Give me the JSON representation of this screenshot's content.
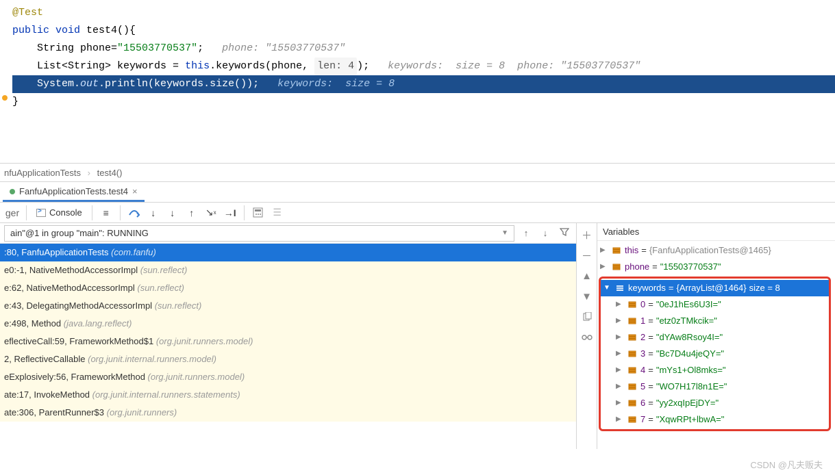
{
  "editor": {
    "l1_ann": "@Test",
    "l2_a": "public ",
    "l2_b": "void ",
    "l2_c": "test4(){",
    "l3_a": "String phone=",
    "l3_b": "\"15503770537\"",
    "l3_c": ";",
    "l3_hint": "phone: \"15503770537\"",
    "l4_a": "List<String> keywords = ",
    "l4_b": "this",
    "l4_c": ".keywords(phone, ",
    "l4_len": "len: 4",
    "l4_d": ");",
    "l4_hint": "keywords:  size = 8  phone: \"15503770537\"",
    "l5_a": "System.",
    "l5_b": "out",
    "l5_c": ".println(keywords.size());",
    "l5_hint": "keywords:  size = 8",
    "l6": "}"
  },
  "breadcrumb": {
    "a": "nfuApplicationTests",
    "b": "test4()"
  },
  "tab": {
    "label": "FanfuApplicationTests.test4",
    "close": "×"
  },
  "toolbar": {
    "ger": "ger",
    "console": "Console"
  },
  "thread": {
    "text": "ain\"@1 in group \"main\": RUNNING",
    "filter_arrow": "↑",
    "filter_down": "↓"
  },
  "stack_sel": {
    "a": ":80, FanfuApplicationTests ",
    "b": "(com.fanfu)"
  },
  "stack": [
    {
      "a": "e0:-1, NativeMethodAccessorImpl ",
      "b": "(sun.reflect)"
    },
    {
      "a": "e:62, NativeMethodAccessorImpl ",
      "b": "(sun.reflect)"
    },
    {
      "a": "e:43, DelegatingMethodAccessorImpl ",
      "b": "(sun.reflect)"
    },
    {
      "a": "e:498, Method ",
      "b": "(java.lang.reflect)"
    },
    {
      "a": "eflectiveCall:59, FrameworkMethod$1 ",
      "b": "(org.junit.runners.model)"
    },
    {
      "a": "2, ReflectiveCallable ",
      "b": "(org.junit.internal.runners.model)"
    },
    {
      "a": "eExplosively:56, FrameworkMethod ",
      "b": "(org.junit.runners.model)"
    },
    {
      "a": "ate:17, InvokeMethod ",
      "b": "(org.junit.internal.runners.statements)"
    },
    {
      "a": "ate:306, ParentRunner$3 ",
      "b": "(org.junit.runners)"
    }
  ],
  "vars": {
    "header": "Variables",
    "this": {
      "name": "this",
      "eq": " = ",
      "val": "{FanfuApplicationTests@1465}"
    },
    "phone": {
      "name": "phone",
      "eq": " = ",
      "val": "\"15503770537\""
    },
    "keywords": {
      "name": "keywords",
      "eq": " = ",
      "obj": "{ArrayList@1464}",
      "size": "  size = 8"
    },
    "items": [
      {
        "idx": "0",
        "eq": " = ",
        "val": "\"0eJ1hEs6U3I=\""
      },
      {
        "idx": "1",
        "eq": " = ",
        "val": "\"etz0zTMkcik=\""
      },
      {
        "idx": "2",
        "eq": " = ",
        "val": "\"dYAw8Rsoy4I=\""
      },
      {
        "idx": "3",
        "eq": " = ",
        "val": "\"Bc7D4u4jeQY=\""
      },
      {
        "idx": "4",
        "eq": " = ",
        "val": "\"mYs1+Ol8mks=\""
      },
      {
        "idx": "5",
        "eq": " = ",
        "val": "\"WO7H17l8n1E=\""
      },
      {
        "idx": "6",
        "eq": " = ",
        "val": "\"yy2xqIpEjDY=\""
      },
      {
        "idx": "7",
        "eq": " = ",
        "val": "\"XqwRPt+lbwA=\""
      }
    ]
  },
  "watermark": "CSDN @凡夫贩夫"
}
